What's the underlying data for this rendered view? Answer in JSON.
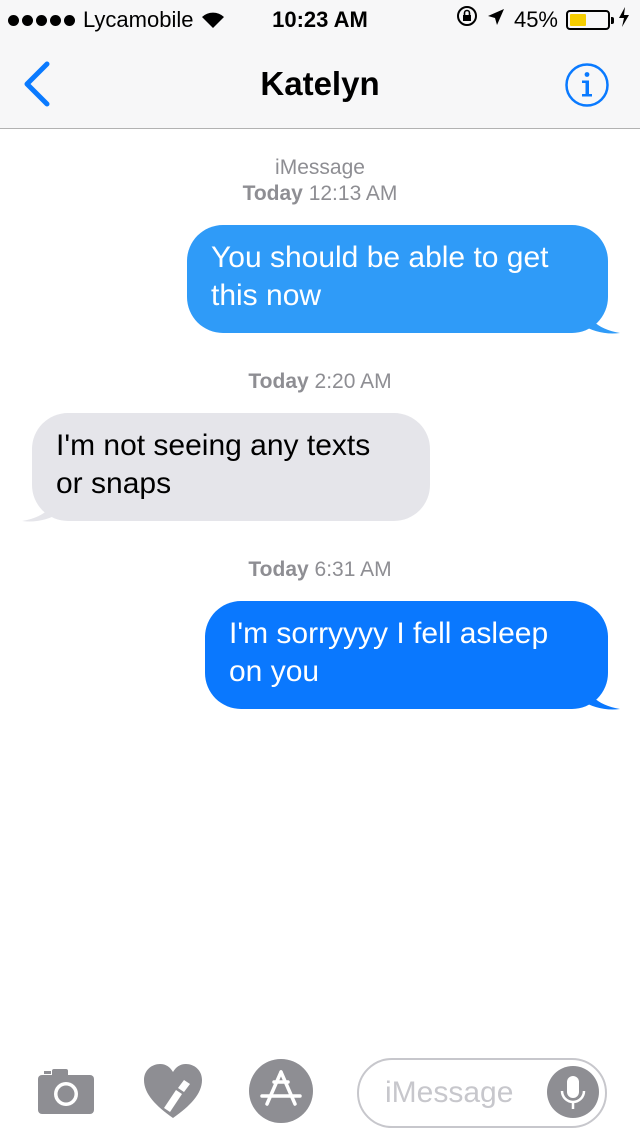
{
  "status_bar": {
    "carrier": "Lycamobile",
    "time": "10:23 AM",
    "battery_percent": "45%",
    "battery_level": 0.45,
    "icons": [
      "signal-dots-icon",
      "wifi-icon",
      "rotation-lock-icon",
      "location-arrow-icon",
      "battery-icon",
      "charging-bolt-icon"
    ]
  },
  "nav": {
    "title": "Katelyn",
    "back_icon": "chevron-left-icon",
    "info_icon": "info-icon"
  },
  "messages": [
    {
      "type": "timestamp",
      "service": "iMessage",
      "day": "Today",
      "time": "12:13 AM"
    },
    {
      "type": "bubble",
      "direction": "outgoing",
      "color": "#2f9bf8",
      "lines": [
        "You should be able to get",
        "this now"
      ]
    },
    {
      "type": "timestamp",
      "day": "Today",
      "time": "2:20 AM"
    },
    {
      "type": "bubble",
      "direction": "incoming",
      "color": "#e5e5ea",
      "lines": [
        "I'm not seeing any texts",
        "or snaps"
      ]
    },
    {
      "type": "timestamp",
      "day": "Today",
      "time": "6:31 AM"
    },
    {
      "type": "bubble",
      "direction": "outgoing",
      "color": "#0a78fe",
      "lines": [
        "I'm sorryyyy I fell asleep",
        "on you"
      ]
    }
  ],
  "input_bar": {
    "placeholder": "iMessage",
    "icons": [
      "camera-icon",
      "digital-touch-heart-icon",
      "app-store-icon",
      "microphone-icon"
    ]
  },
  "colors": {
    "accent": "#0a7aff",
    "bar_background": "#f7f7f8",
    "incoming_bubble": "#e5e5ea",
    "timestamp_text": "#8e8e93",
    "battery_fill": "#f5cd00"
  }
}
